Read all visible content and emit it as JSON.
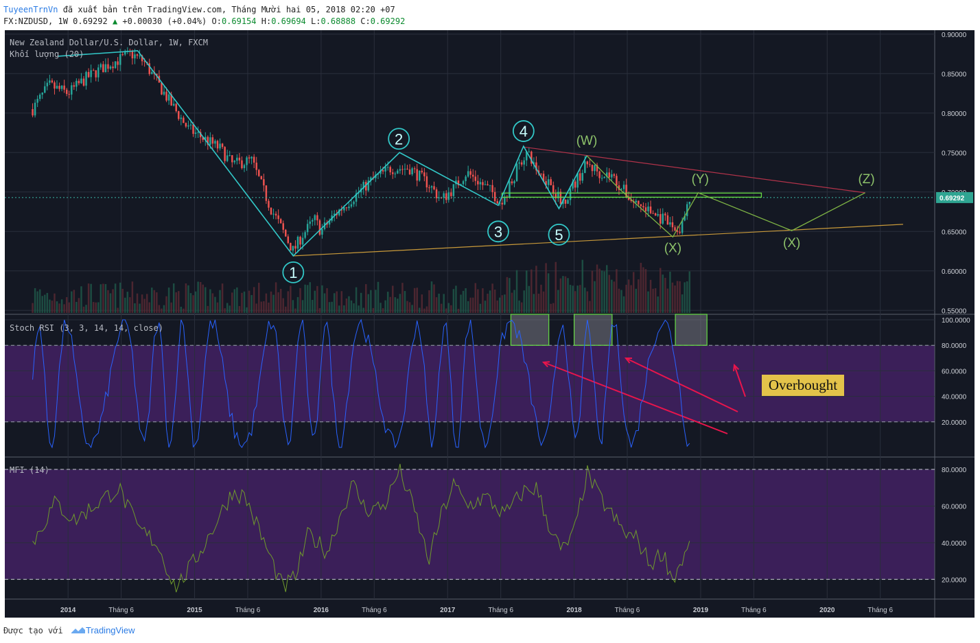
{
  "header": {
    "author": "TuyeenTrnVn",
    "published_text": " đã xuất bản trên TradingView.com, Tháng Mười hai 05, 2018 02:20 +07",
    "symbol_line": "FX:NZDUSD, 1W 0.69292",
    "change": "+0.00030 (+0.04%)",
    "o_label": "O:",
    "o_value": "0.69154",
    "h_label": "H:",
    "h_value": "0.69694",
    "l_label": "L:",
    "l_value": "0.68888",
    "c_label": "C:",
    "c_value": "0.69292"
  },
  "footer": {
    "created_with": "Được tạo với",
    "brand": "TradingView"
  },
  "colors": {
    "background": "#141823",
    "grid": "#2a2f3c",
    "bull": "#26a69a",
    "bear": "#ef5350",
    "wave": "#32c8c8",
    "wave2": "#7fb545",
    "stoch_line": "#2962ff",
    "mfi_line": "#6f9a2c",
    "indicator_fill": "#3b1f59",
    "trend_support": "#c99a3a",
    "trend_resistance": "#b3334a",
    "overbought_box": "#66dd44",
    "arrow": "#e8154c",
    "label_box": "#e3c34a"
  },
  "annotations": {
    "overbought": "Overbought",
    "wave_labels": [
      "1",
      "2",
      "3",
      "4",
      "5"
    ],
    "correction_labels": [
      "(W)",
      "(X)",
      "(Y)",
      "(X)",
      "(Z)"
    ]
  },
  "chart_data": [
    {
      "type": "candlestick",
      "pane": "price",
      "title": "New Zealand Dollar/U.S. Dollar, 1W, FXCM",
      "secondary_title": "Khối lượng (20)",
      "x_ticks": [
        "2014",
        "Tháng 6",
        "2015",
        "Tháng 6",
        "2016",
        "Tháng 6",
        "2017",
        "Tháng 6",
        "2018",
        "Tháng 6",
        "2019",
        "Tháng 6",
        "2020",
        "Tháng 6"
      ],
      "y_ticks": [
        "0.90000",
        "0.85000",
        "0.80000",
        "0.75000",
        "0.70000",
        "0.65000",
        "0.60000",
        "0.55000"
      ],
      "ylim": [
        0.545,
        0.905
      ],
      "last_price": "0.69292",
      "price_path": [
        [
          2013.72,
          0.805
        ],
        [
          2013.85,
          0.835
        ],
        [
          2014.0,
          0.825
        ],
        [
          2014.15,
          0.845
        ],
        [
          2014.3,
          0.86
        ],
        [
          2014.5,
          0.875
        ],
        [
          2014.6,
          0.865
        ],
        [
          2014.8,
          0.815
        ],
        [
          2014.95,
          0.78
        ],
        [
          2015.05,
          0.77
        ],
        [
          2015.2,
          0.755
        ],
        [
          2015.3,
          0.735
        ],
        [
          2015.45,
          0.74
        ],
        [
          2015.6,
          0.68
        ],
        [
          2015.7,
          0.65
        ],
        [
          2015.78,
          0.625
        ],
        [
          2015.85,
          0.645
        ],
        [
          2015.95,
          0.665
        ],
        [
          2016.0,
          0.65
        ],
        [
          2016.1,
          0.67
        ],
        [
          2016.2,
          0.685
        ],
        [
          2016.4,
          0.715
        ],
        [
          2016.55,
          0.73
        ],
        [
          2016.7,
          0.73
        ],
        [
          2016.85,
          0.71
        ],
        [
          2016.95,
          0.69
        ],
        [
          2017.05,
          0.705
        ],
        [
          2017.15,
          0.725
        ],
        [
          2017.35,
          0.7
        ],
        [
          2017.43,
          0.685
        ],
        [
          2017.55,
          0.73
        ],
        [
          2017.62,
          0.75
        ],
        [
          2017.72,
          0.725
        ],
        [
          2017.82,
          0.71
        ],
        [
          2017.9,
          0.685
        ],
        [
          2018.0,
          0.71
        ],
        [
          2018.1,
          0.735
        ],
        [
          2018.2,
          0.725
        ],
        [
          2018.3,
          0.72
        ],
        [
          2018.45,
          0.69
        ],
        [
          2018.6,
          0.675
        ],
        [
          2018.7,
          0.665
        ],
        [
          2018.78,
          0.655
        ],
        [
          2018.83,
          0.65
        ],
        [
          2018.92,
          0.69
        ]
      ],
      "wave_points": {
        "1": [
          2015.78,
          0.619
        ],
        "2": [
          2016.62,
          0.75
        ],
        "3": [
          2017.4,
          0.683
        ],
        "4": [
          2017.6,
          0.758
        ],
        "5": [
          2017.88,
          0.679
        ],
        "W": [
          2018.1,
          0.746
        ],
        "X_low": [
          2018.78,
          0.643
        ],
        "Y": [
          2018.98,
          0.699
        ],
        "X_proj": [
          2019.72,
          0.651
        ],
        "Z": [
          2020.3,
          0.699
        ]
      },
      "levels": {
        "horizontal_resistance": 0.696,
        "support_start": [
          2015.78,
          0.619
        ],
        "support_end": [
          2020.6,
          0.659
        ],
        "resistance_start": [
          2017.6,
          0.757
        ],
        "resistance_end": [
          2020.3,
          0.699
        ]
      }
    },
    {
      "type": "line",
      "pane": "stoch_rsi",
      "title": "Stoch RSI (3, 3, 14, 14, close)",
      "y_ticks": [
        "100.0000",
        "80.0000",
        "60.0000",
        "40.0000",
        "20.0000"
      ],
      "ylim": [
        0,
        100
      ],
      "levels": [
        80,
        20
      ],
      "overbought_zones": [
        [
          2017.5,
          2017.8
        ],
        [
          2018.0,
          2018.3
        ],
        [
          2018.8,
          2019.05
        ]
      ]
    },
    {
      "type": "line",
      "pane": "mfi",
      "title": "MFI (14)",
      "y_ticks": [
        "80.0000",
        "60.0000",
        "40.0000",
        "20.0000"
      ],
      "ylim": [
        13,
        83
      ],
      "levels": [
        80,
        20
      ],
      "values_sample": [
        [
          2013.72,
          40
        ],
        [
          2013.9,
          62
        ],
        [
          2014.05,
          52
        ],
        [
          2014.2,
          60
        ],
        [
          2014.4,
          70
        ],
        [
          2014.55,
          48
        ],
        [
          2014.7,
          40
        ],
        [
          2014.85,
          15
        ],
        [
          2015.0,
          30
        ],
        [
          2015.1,
          42
        ],
        [
          2015.2,
          55
        ],
        [
          2015.3,
          68
        ],
        [
          2015.4,
          65
        ],
        [
          2015.55,
          40
        ],
        [
          2015.7,
          15
        ],
        [
          2015.8,
          22
        ],
        [
          2015.9,
          45
        ],
        [
          2016.05,
          35
        ],
        [
          2016.15,
          55
        ],
        [
          2016.25,
          72
        ],
        [
          2016.35,
          58
        ],
        [
          2016.5,
          60
        ],
        [
          2016.62,
          80
        ],
        [
          2016.75,
          55
        ],
        [
          2016.85,
          30
        ],
        [
          2016.95,
          55
        ],
        [
          2017.05,
          72
        ],
        [
          2017.15,
          60
        ],
        [
          2017.3,
          65
        ],
        [
          2017.45,
          55
        ],
        [
          2017.6,
          68
        ],
        [
          2017.7,
          70
        ],
        [
          2017.8,
          50
        ],
        [
          2017.9,
          35
        ],
        [
          2018.0,
          45
        ],
        [
          2018.1,
          78
        ],
        [
          2018.2,
          65
        ],
        [
          2018.3,
          55
        ],
        [
          2018.4,
          45
        ],
        [
          2018.5,
          42
        ],
        [
          2018.6,
          28
        ],
        [
          2018.7,
          35
        ],
        [
          2018.78,
          20
        ],
        [
          2018.85,
          30
        ],
        [
          2018.95,
          42
        ],
        [
          2019.0,
          48
        ]
      ]
    }
  ]
}
